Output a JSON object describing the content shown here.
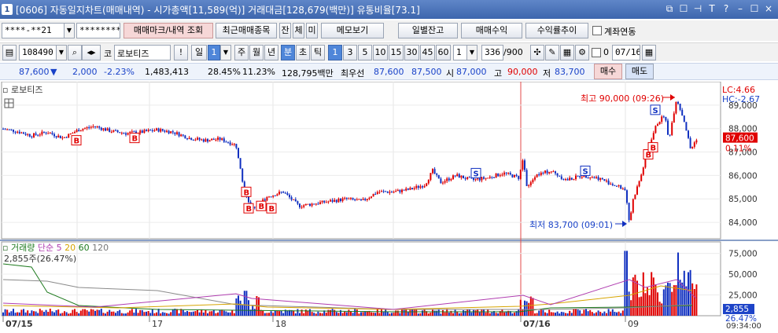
{
  "window": {
    "number": "1",
    "title": "[0606] 자동일지차트(매매내역) - 시가총액[11,589(억)] 거래대금[128,679(백만)] 유통비율[73.1]",
    "buttons": [
      "⧉",
      "☐",
      "⊣",
      "T",
      "?",
      "–",
      "☐",
      "×"
    ]
  },
  "toolbar1": {
    "account": "****-**21",
    "password": "********",
    "trade_mark_btn": "매매마크/내역 조회",
    "recent_btn": "최근매매종목",
    "chip_jan": "잔",
    "chip_che": "체",
    "chip_mi": "미",
    "memo_btn": "메모보기",
    "daily_btn": "일별잔고",
    "trade_profit_btn": "매매수익",
    "yield_btn": "수익률추이",
    "account_link_label": "계좌연동"
  },
  "toolbar2": {
    "code": "108490",
    "market": "코",
    "stock_name": "로보티즈",
    "bang": "!",
    "period_label": "일",
    "period_value": "1",
    "periods": [
      "주",
      "월",
      "년",
      "분",
      "초",
      "틱"
    ],
    "active_period": "분",
    "intervals": [
      "1",
      "3",
      "5",
      "10",
      "15",
      "30",
      "45",
      "60"
    ],
    "active_interval": "1",
    "custom_interval": "1",
    "count": "336",
    "count_max": "/900",
    "date_chk_label": "0",
    "date": "07/16"
  },
  "quote": {
    "price": "87,600",
    "arrow": "▼",
    "change": "2,000",
    "change_pct": "-2.23%",
    "volume": "1,483,413",
    "turnover": "28.45%",
    "ratio": "11.23%",
    "amount": "128,795백만",
    "best_label": "최우선",
    "best_ask": "87,600",
    "best_bid": "87,500",
    "open_label": "시",
    "open": "87,000",
    "high_label": "고",
    "high": "90,000",
    "low_label": "저",
    "low": "83,700",
    "buy_btn": "매수",
    "sell_btn": "매도"
  },
  "chart": {
    "stock_tag": "로보티즈",
    "lc": "LC:4.66",
    "hc": "HC:-2.67",
    "high_annot": "최고 90,000 (09:26)",
    "low_annot": "최저 83,700 (09:01)",
    "current_price_tag": "87,600",
    "current_pct_tag": "0.11%",
    "price_ticks": [
      "89,000",
      "88,000",
      "87,000",
      "86,000",
      "85,000",
      "84,000"
    ],
    "volume_legend": {
      "label": "거래량",
      "ma_label": "단순",
      "mas": [
        "5",
        "20",
        "60",
        "120"
      ]
    },
    "volume_info": "2,855주(26.47%)",
    "volume_ticks": [
      "75,000",
      "50,000",
      "25,000"
    ],
    "volume_tag": "2,855",
    "volume_pct_tag": "26.47%",
    "x_labels": [
      "07/15",
      "17",
      "18",
      "07/16",
      "09"
    ],
    "time_label": "09:34:00",
    "marker_b": "B",
    "marker_s": "S"
  },
  "colors": {
    "up": "#e00000",
    "down": "#1030c0",
    "accent": "#4f86d9",
    "title_bg": "#3d66ad"
  },
  "chart_data": {
    "type": "candlestick",
    "title": "로보티즈",
    "y_range": [
      83500,
      89800
    ],
    "y_ticks": [
      89000,
      88000,
      87000,
      86000,
      85000,
      84000
    ],
    "volume_range": [
      0,
      85000
    ],
    "volume_ticks": [
      75000,
      50000,
      25000
    ],
    "x_labels": [
      "07/15",
      "17",
      "18",
      "07/16",
      "09"
    ],
    "price_path": [
      [
        0,
        88000
      ],
      [
        20,
        87900
      ],
      [
        40,
        87700
      ],
      [
        60,
        87850
      ],
      [
        80,
        87600
      ],
      [
        100,
        87950
      ],
      [
        120,
        88100
      ],
      [
        140,
        87900
      ],
      [
        160,
        87800
      ],
      [
        180,
        87850
      ],
      [
        200,
        87950
      ],
      [
        220,
        87850
      ],
      [
        240,
        87600
      ],
      [
        260,
        87500
      ],
      [
        280,
        87550
      ],
      [
        300,
        87300
      ],
      [
        305,
        86500
      ],
      [
        310,
        85400
      ],
      [
        320,
        84600
      ],
      [
        330,
        84800
      ],
      [
        340,
        85100
      ],
      [
        360,
        85300
      ],
      [
        380,
        84700
      ],
      [
        400,
        84800
      ],
      [
        420,
        84900
      ],
      [
        440,
        85000
      ],
      [
        460,
        84900
      ],
      [
        480,
        85300
      ],
      [
        500,
        85300
      ],
      [
        520,
        85400
      ],
      [
        540,
        85600
      ],
      [
        550,
        86200
      ],
      [
        560,
        85700
      ],
      [
        580,
        86000
      ],
      [
        600,
        85800
      ],
      [
        620,
        85900
      ],
      [
        640,
        86100
      ],
      [
        660,
        85900
      ],
      [
        665,
        86800
      ],
      [
        670,
        85400
      ],
      [
        680,
        86000
      ],
      [
        700,
        86200
      ],
      [
        720,
        85800
      ],
      [
        740,
        86000
      ],
      [
        760,
        85900
      ],
      [
        780,
        85600
      ],
      [
        795,
        85400
      ],
      [
        800,
        84000
      ],
      [
        805,
        85000
      ],
      [
        815,
        86000
      ],
      [
        825,
        87300
      ],
      [
        835,
        88200
      ],
      [
        845,
        88600
      ],
      [
        850,
        87500
      ],
      [
        860,
        89300
      ],
      [
        870,
        88300
      ],
      [
        878,
        87100
      ],
      [
        886,
        87600
      ]
    ],
    "buy_markers": [
      [
        97,
        87500
      ],
      [
        171,
        87600
      ],
      [
        313,
        85300
      ],
      [
        316,
        84600
      ],
      [
        332,
        84700
      ],
      [
        345,
        84600
      ],
      [
        824,
        86900
      ],
      [
        830,
        87200
      ]
    ],
    "sell_markers": [
      [
        605,
        86100
      ],
      [
        744,
        86200
      ],
      [
        833,
        88800
      ]
    ],
    "high": {
      "value": 90000,
      "time": "09:26"
    },
    "low": {
      "value": 83700,
      "time": "09:01"
    }
  }
}
